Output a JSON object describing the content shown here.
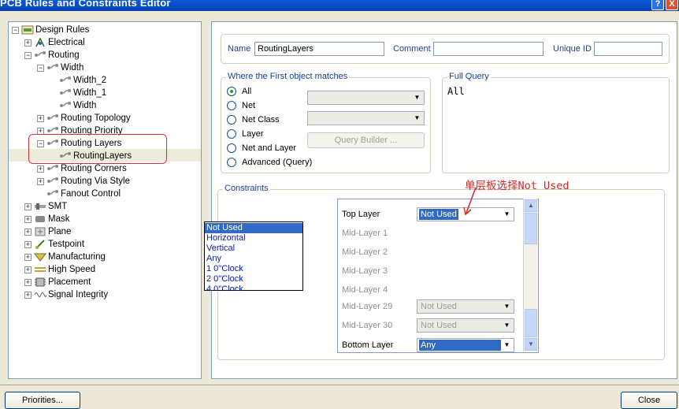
{
  "window": {
    "title": "PCB Rules and Constraints Editor",
    "help_label": "?",
    "close_label": "X"
  },
  "tree": {
    "root": "Design Rules",
    "items": [
      {
        "label": "Electrical"
      },
      {
        "label": "Routing"
      },
      {
        "label": "Width"
      },
      {
        "label": "Width_2"
      },
      {
        "label": "Width_1"
      },
      {
        "label": "Width"
      },
      {
        "label": "Routing Topology"
      },
      {
        "label": "Routing Priority"
      },
      {
        "label": "Routing Layers"
      },
      {
        "label": "RoutingLayers"
      },
      {
        "label": "Routing Corners"
      },
      {
        "label": "Routing Via Style"
      },
      {
        "label": "Fanout Control"
      },
      {
        "label": "SMT"
      },
      {
        "label": "Mask"
      },
      {
        "label": "Plane"
      },
      {
        "label": "Testpoint"
      },
      {
        "label": "Manufacturing"
      },
      {
        "label": "High Speed"
      },
      {
        "label": "Placement"
      },
      {
        "label": "Signal Integrity"
      }
    ]
  },
  "rule": {
    "name_label": "Name",
    "name_value": "RoutingLayers",
    "comment_label": "Comment",
    "comment_value": "",
    "uid_label": "Unique ID",
    "uid_value": ""
  },
  "match": {
    "title": "Where the First object matches",
    "options": [
      "All",
      "Net",
      "Net Class",
      "Layer",
      "Net and Layer",
      "Advanced (Query)"
    ],
    "selected": "All",
    "query_builder_label": "Query Builder ..."
  },
  "full_query": {
    "title": "Full Query",
    "value": "All"
  },
  "constraints": {
    "title": "Constraints",
    "annotation": "单层板选择Not Used",
    "layers": [
      {
        "label": "Top Layer",
        "value": "Not Used"
      },
      {
        "label": "Mid-Layer 1",
        "value": ""
      },
      {
        "label": "Mid-Layer 2",
        "value": ""
      },
      {
        "label": "Mid-Layer 3",
        "value": ""
      },
      {
        "label": "Mid-Layer 4",
        "value": ""
      },
      {
        "label": "Mid-Layer 29",
        "value": "Not Used"
      },
      {
        "label": "Mid-Layer 30",
        "value": "Not Used"
      },
      {
        "label": "Bottom Layer",
        "value": "Any"
      }
    ],
    "dropdown_options": [
      "Not Used",
      "Horizontal",
      "Vertical",
      "Any",
      "1 0\"Clock",
      "2 0\"Clock",
      "4 0\"Clock"
    ]
  },
  "buttons": {
    "priorities": "Priorities...",
    "close": "Close"
  },
  "colors": {
    "titlebar": "#0a5ad8",
    "selection": "#316ac5",
    "annotation": "#d62626"
  }
}
